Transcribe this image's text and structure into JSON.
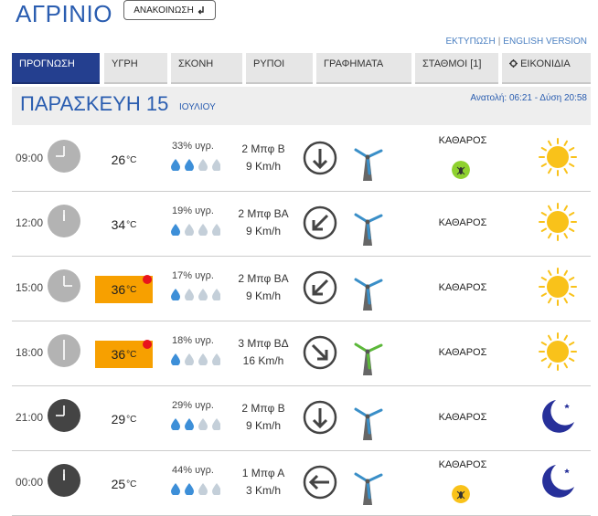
{
  "header": {
    "title": "ΑΓΡΙΝΙΟ",
    "announce_label": "ΑΝΑΚΟΙΝΩΣΗ",
    "announce_icon": "return-arrow-icon",
    "print_link": "ΕΚΤΥΠΩΣΗ",
    "separator": "|",
    "english_link": "ENGLISH VERSION"
  },
  "tabs": [
    {
      "label": "ΠΡΟΓΝΩΣΗ",
      "active": true
    },
    {
      "label": "ΥΓΡΗ",
      "active": false
    },
    {
      "label": "ΣΚΟΝΗ",
      "active": false
    },
    {
      "label": "ΡΥΠΟΙ",
      "active": false
    },
    {
      "label": "ΓΡΑΦΗΜΑΤΑ",
      "active": false
    },
    {
      "label": "ΣΤΑΘΜΟΙ [1]",
      "active": false
    },
    {
      "label": "ΕΙΚΟΝΙΔΙΑ",
      "active": false,
      "icon": "gear-icon"
    }
  ],
  "day": {
    "name": "ΠΑΡΑΣΚΕΥΗ 15",
    "month": "ΙΟΥΛΙΟΥ",
    "sun_times": "Ανατολή: 06:21 - Δύση 20:58"
  },
  "colors": {
    "accent": "#2a5db0",
    "active_tab": "#243f8f",
    "hot": "#f7a000",
    "alert_dot": "#e8141c",
    "drop_on": "#3d8fd8",
    "drop_off": "#c4cfd9",
    "sun": "#f9c21a",
    "moon": "#27309a",
    "insect_bg_green": "#8fd12f",
    "insect_bg_yellow": "#f9c21a"
  },
  "rows": [
    {
      "time": "09:00",
      "temp": "26",
      "unit": "°C",
      "hot": false,
      "alert": false,
      "humidity": "33% υγρ.",
      "humidity_drops": 2,
      "wind_force": "2 Μπφ Β",
      "wind_speed": "9 Km/h",
      "wind_direction": "down-arrow-icon",
      "turbine": "blue",
      "condition": "ΚΑΘΑΡΟΣ",
      "insect": "green",
      "weather": "sun-icon",
      "clock": "light"
    },
    {
      "time": "12:00",
      "temp": "34",
      "unit": "°C",
      "hot": false,
      "alert": false,
      "humidity": "19% υγρ.",
      "humidity_drops": 1,
      "wind_force": "2 Μπφ ΒΑ",
      "wind_speed": "9 Km/h",
      "wind_direction": "down-left-arrow-icon",
      "turbine": "blue",
      "condition": "ΚΑΘΑΡΟΣ",
      "insect": "",
      "weather": "sun-icon",
      "clock": "light"
    },
    {
      "time": "15:00",
      "temp": "36",
      "unit": "°C",
      "hot": true,
      "alert": true,
      "humidity": "17% υγρ.",
      "humidity_drops": 1,
      "wind_force": "2 Μπφ ΒΑ",
      "wind_speed": "9 Km/h",
      "wind_direction": "down-left-arrow-icon",
      "turbine": "blue",
      "condition": "ΚΑΘΑΡΟΣ",
      "insect": "",
      "weather": "sun-icon",
      "clock": "light"
    },
    {
      "time": "18:00",
      "temp": "36",
      "unit": "°C",
      "hot": true,
      "alert": true,
      "humidity": "18% υγρ.",
      "humidity_drops": 1,
      "wind_force": "3 Μπφ ΒΔ",
      "wind_speed": "16 Km/h",
      "wind_direction": "down-right-arrow-icon",
      "turbine": "green",
      "condition": "ΚΑΘΑΡΟΣ",
      "insect": "",
      "weather": "sun-icon",
      "clock": "light"
    },
    {
      "time": "21:00",
      "temp": "29",
      "unit": "°C",
      "hot": false,
      "alert": false,
      "humidity": "29% υγρ.",
      "humidity_drops": 2,
      "wind_force": "2 Μπφ Β",
      "wind_speed": "9 Km/h",
      "wind_direction": "down-arrow-icon",
      "turbine": "blue",
      "condition": "ΚΑΘΑΡΟΣ",
      "insect": "",
      "weather": "moon-icon",
      "clock": "dark"
    },
    {
      "time": "00:00",
      "temp": "25",
      "unit": "°C",
      "hot": false,
      "alert": false,
      "humidity": "44% υγρ.",
      "humidity_drops": 2,
      "wind_force": "1 Μπφ Α",
      "wind_speed": "3 Km/h",
      "wind_direction": "left-arrow-icon",
      "turbine": "blue",
      "condition": "ΚΑΘΑΡΟΣ",
      "insect": "yellow",
      "weather": "moon-icon",
      "clock": "dark"
    }
  ]
}
